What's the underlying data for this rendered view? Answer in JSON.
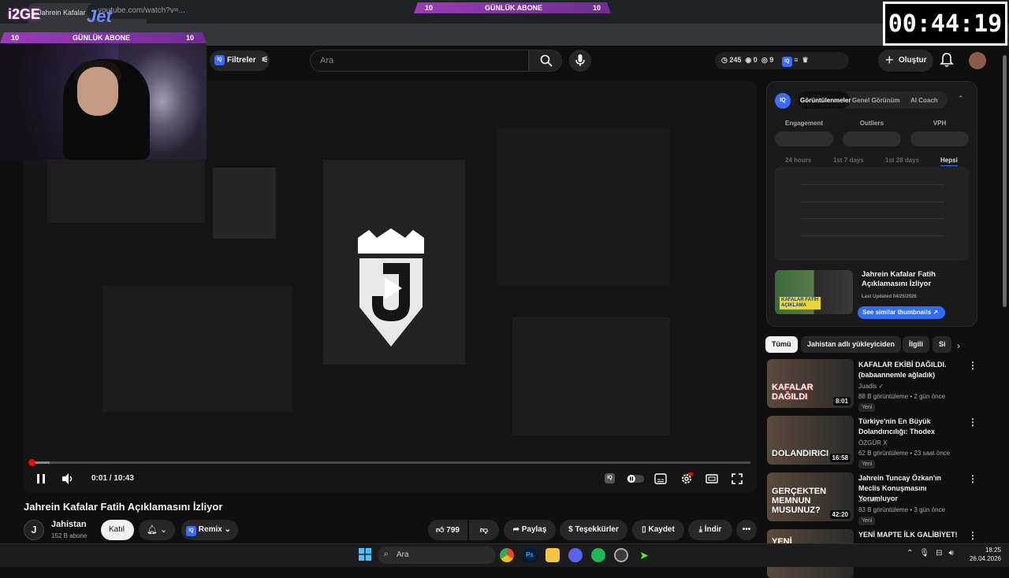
{
  "browser": {
    "tab_title": "Jahrein Kafalar Fatih Açıkl...",
    "tab_close": "✕",
    "new_tab": "+",
    "address": "youtube.com/watch?v=..."
  },
  "overlay": {
    "top_banner": {
      "left": "10",
      "label": "GÜNLÜK ABONE",
      "right": "10"
    },
    "side_banner": {
      "left": "10",
      "label": "GÜNLÜK ABONE",
      "right": "10"
    },
    "brand_left": "i2GE",
    "brand_right": "Jet",
    "timer": "00:44:19"
  },
  "topbar": {
    "filters_label": "Filtreler",
    "filters_badge": "IQ",
    "search_placeholder": "Ara",
    "stats": {
      "time": "245",
      "views": "0",
      "eye": "9"
    },
    "create_label": "Oluştur"
  },
  "player": {
    "time": "0:01 / 10:43",
    "progress": 0.002
  },
  "video": {
    "title": "Jahrein Kafalar Fatih Açıklamasını İzliyor",
    "channel": "Jahistan",
    "channel_initial": "J",
    "subs": "152 B abone",
    "join": "Katıl",
    "remix": "Remix",
    "likes": "799",
    "share": "Paylaş",
    "thanks": "Teşekkürler",
    "save": "Kaydet",
    "download": "İndir",
    "more": "•••"
  },
  "panel": {
    "badge": "IQ",
    "tabs": [
      "Görüntülenmeler",
      "Genel Görünüm",
      "AI Coach"
    ],
    "metrics": [
      "Engagement",
      "Outliers",
      "VPH"
    ],
    "ranges": [
      "24 hours",
      "1st 7 days",
      "1st 28 days",
      "Hepsi"
    ],
    "thumb_title": "Jahrein Kafalar Fatih Açıklamasını İzliyor",
    "thumb_caption": "KAFALAR FATİH AÇIKLAMA",
    "last_updated": "Last Updated 04/25/2026",
    "similar": "See similar thumbnails ↗"
  },
  "chips": [
    "Tümü",
    "Jahistan adlı yükleyiciden",
    "İlgili",
    "Si"
  ],
  "recommended": [
    {
      "title": "KAFALAR EKİBİ DAĞILDI. (babaannemle ağladık)",
      "channel": "Juadis ✓",
      "meta": "88 B görüntüleme • 2 gün önce",
      "badge": "Yeni",
      "duration": "8:01",
      "thumb_text": "KAFALAR DAĞILDI",
      "color": "#c33"
    },
    {
      "title": "Türkiye'nin En Büyük Dolandırıcılığı: Thodex",
      "channel": "ÖZGÜR X",
      "meta": "62 B görüntüleme • 23 saat önce",
      "badge": "Yeni",
      "duration": "16:58",
      "thumb_text": "DOLANDIRICI",
      "color": "#333"
    },
    {
      "title": "Jahrein Tuncay Özkan'ın Meclis Konuşmasını Yorumluyor",
      "channel": "Jahistan",
      "meta": "83 B görüntüleme • 3 gün önce",
      "badge": "Yeni",
      "duration": "42:20",
      "thumb_text": "GERÇEKTEN MEMNUN MUSUNUZ?",
      "color": "#4a3a2a"
    },
    {
      "title": "YENİ MAPTE İLK GALİBİYET!",
      "channel": "",
      "meta": "",
      "badge": "",
      "duration": "",
      "thumb_text": "YENİ",
      "color": "#6a5a20"
    }
  ],
  "taskbar": {
    "search": "Ara",
    "time": "18:25",
    "date": "26.04.2026"
  }
}
